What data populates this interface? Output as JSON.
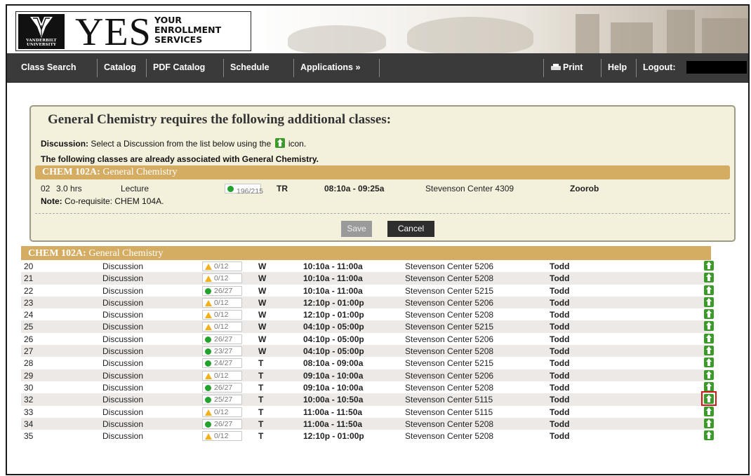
{
  "logo": {
    "university": "VANDERBILT UNIVERSITY",
    "yes": "YES",
    "sub_line1": "YOUR",
    "sub_line2": "ENROLLMENT",
    "sub_line3": "SERVICES"
  },
  "nav": {
    "class_search": "Class Search",
    "catalog": "Catalog",
    "pdf_catalog": "PDF Catalog",
    "schedule": "Schedule",
    "applications": "Applications »",
    "print": "Print",
    "help": "Help",
    "logout": "Logout:"
  },
  "panel": {
    "title": "General Chemistry requires the following additional classes:",
    "discussion_label": "Discussion:",
    "discussion_text_a": "Select a Discussion from the list below using the",
    "discussion_text_b": "icon.",
    "associated_text": "The following classes are already associated with General Chemistry.",
    "course_code": "CHEM 102A:",
    "course_name": "General Chemistry",
    "assoc": {
      "section": "02",
      "hours": "3.0 hrs",
      "component": "Lecture",
      "seats": "196/215",
      "seat_status": "open",
      "days": "TR",
      "time": "08:10a - 09:25a",
      "location": "Stevenson Center 4309",
      "instructor": "Zoorob"
    },
    "note_label": "Note:",
    "note_text": "Co-requisite: CHEM 104A.",
    "save": "Save",
    "cancel": "Cancel"
  },
  "list": {
    "course_code": "CHEM 102A:",
    "course_name": "General Chemistry",
    "highlighted_section": "32",
    "rows": [
      {
        "section": "20",
        "component": "Discussion",
        "seats": "0/12",
        "status": "warn",
        "days": "W",
        "time": "10:10a - 11:00a",
        "location": "Stevenson Center 5206",
        "instructor": "Todd"
      },
      {
        "section": "21",
        "component": "Discussion",
        "seats": "0/12",
        "status": "warn",
        "days": "W",
        "time": "10:10a - 11:00a",
        "location": "Stevenson Center 5208",
        "instructor": "Todd"
      },
      {
        "section": "22",
        "component": "Discussion",
        "seats": "26/27",
        "status": "open",
        "days": "W",
        "time": "10:10a - 11:00a",
        "location": "Stevenson Center 5215",
        "instructor": "Todd"
      },
      {
        "section": "23",
        "component": "Discussion",
        "seats": "0/12",
        "status": "warn",
        "days": "W",
        "time": "12:10p - 01:00p",
        "location": "Stevenson Center 5206",
        "instructor": "Todd"
      },
      {
        "section": "24",
        "component": "Discussion",
        "seats": "0/12",
        "status": "warn",
        "days": "W",
        "time": "12:10p - 01:00p",
        "location": "Stevenson Center 5208",
        "instructor": "Todd"
      },
      {
        "section": "25",
        "component": "Discussion",
        "seats": "0/12",
        "status": "warn",
        "days": "W",
        "time": "04:10p - 05:00p",
        "location": "Stevenson Center 5215",
        "instructor": "Todd"
      },
      {
        "section": "26",
        "component": "Discussion",
        "seats": "26/27",
        "status": "open",
        "days": "W",
        "time": "04:10p - 05:00p",
        "location": "Stevenson Center 5206",
        "instructor": "Todd"
      },
      {
        "section": "27",
        "component": "Discussion",
        "seats": "23/27",
        "status": "open",
        "days": "W",
        "time": "04:10p - 05:00p",
        "location": "Stevenson Center 5208",
        "instructor": "Todd"
      },
      {
        "section": "28",
        "component": "Discussion",
        "seats": "24/27",
        "status": "open",
        "days": "T",
        "time": "08:10a - 09:00a",
        "location": "Stevenson Center 5215",
        "instructor": "Todd"
      },
      {
        "section": "29",
        "component": "Discussion",
        "seats": "0/12",
        "status": "warn",
        "days": "T",
        "time": "09:10a - 10:00a",
        "location": "Stevenson Center 5206",
        "instructor": "Todd"
      },
      {
        "section": "30",
        "component": "Discussion",
        "seats": "26/27",
        "status": "open",
        "days": "T",
        "time": "09:10a - 10:00a",
        "location": "Stevenson Center 5208",
        "instructor": "Todd"
      },
      {
        "section": "32",
        "component": "Discussion",
        "seats": "25/27",
        "status": "open",
        "days": "T",
        "time": "10:00a - 10:50a",
        "location": "Stevenson Center 5115",
        "instructor": "Todd"
      },
      {
        "section": "33",
        "component": "Discussion",
        "seats": "0/12",
        "status": "warn",
        "days": "T",
        "time": "11:00a - 11:50a",
        "location": "Stevenson Center 5115",
        "instructor": "Todd"
      },
      {
        "section": "34",
        "component": "Discussion",
        "seats": "26/27",
        "status": "open",
        "days": "T",
        "time": "11:00a - 11:50a",
        "location": "Stevenson Center 5208",
        "instructor": "Todd"
      },
      {
        "section": "35",
        "component": "Discussion",
        "seats": "0/12",
        "status": "warn",
        "days": "T",
        "time": "12:10p - 01:00p",
        "location": "Stevenson Center 5208",
        "instructor": "Todd"
      }
    ]
  },
  "colors": {
    "nav_bg": "#3a3a3a",
    "section_header": "#d4ac62",
    "panel_bg": "#f3f0dc",
    "open_seat": "#22a22c",
    "warn_seat": "#f2b01b",
    "add_icon": "#3b9a2a",
    "highlight": "#d01a1a"
  },
  "icons": {
    "add": "arrow-up-icon",
    "open": "green-dot-icon",
    "warn": "warning-triangle-icon",
    "print": "printer-icon"
  }
}
